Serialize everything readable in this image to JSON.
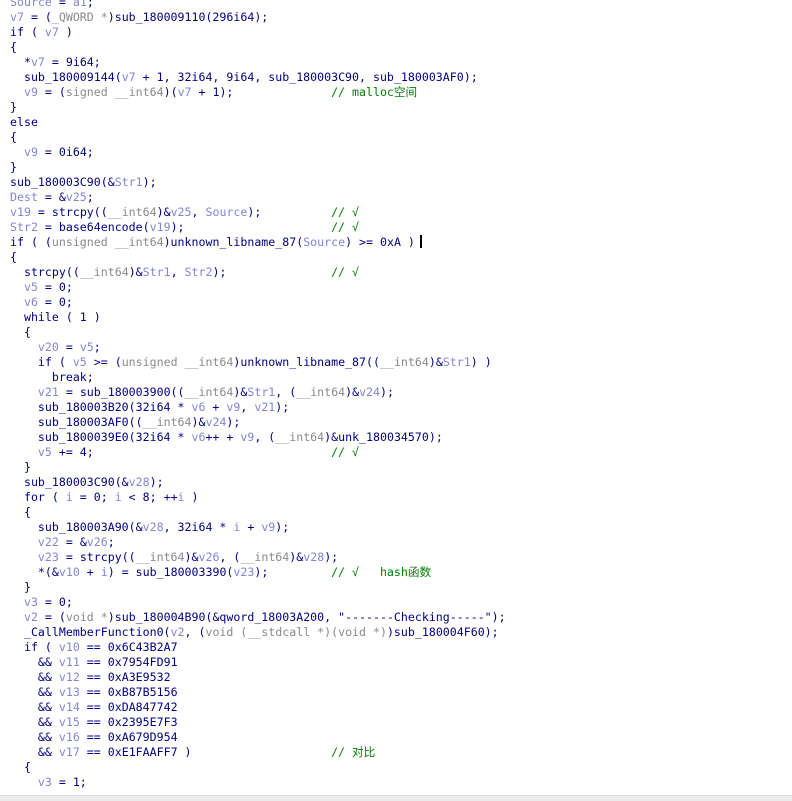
{
  "colors": {
    "identifier": "#000080",
    "variable": "#8484d2",
    "type": "#8a8a8a",
    "comment": "#008000"
  },
  "code": {
    "cursor_line": 16,
    "lines": [
      {
        "tokens": [
          [
            "v",
            "Source"
          ],
          [
            "n",
            " = "
          ],
          [
            "v",
            "a1"
          ],
          [
            "n",
            ";"
          ]
        ]
      },
      {
        "tokens": [
          [
            "v",
            "v7"
          ],
          [
            "n",
            " = ("
          ],
          [
            "t",
            "_QWORD *"
          ],
          [
            "n",
            ")sub_180009110(296i64);"
          ]
        ]
      },
      {
        "tokens": [
          [
            "n",
            "if ( "
          ],
          [
            "v",
            "v7"
          ],
          [
            "n",
            " )"
          ]
        ]
      },
      {
        "tokens": [
          [
            "n",
            "{"
          ]
        ]
      },
      {
        "tokens": [
          [
            "n",
            "  *"
          ],
          [
            "v",
            "v7"
          ],
          [
            "n",
            " = 9i64;"
          ]
        ]
      },
      {
        "tokens": [
          [
            "n",
            "  sub_180009144("
          ],
          [
            "v",
            "v7"
          ],
          [
            "n",
            " + 1, 32i64, 9i64, sub_180003C90, sub_180003AF0);"
          ]
        ]
      },
      {
        "tokens": [
          [
            "n",
            "  "
          ],
          [
            "v",
            "v9"
          ],
          [
            "n",
            " = ("
          ],
          [
            "t",
            "signed __int64"
          ],
          [
            "n",
            ")("
          ],
          [
            "v",
            "v7"
          ],
          [
            "n",
            " + 1);"
          ]
        ],
        "comment": "// malloc空间"
      },
      {
        "tokens": [
          [
            "n",
            "}"
          ]
        ]
      },
      {
        "tokens": [
          [
            "n",
            "else"
          ]
        ]
      },
      {
        "tokens": [
          [
            "n",
            "{"
          ]
        ]
      },
      {
        "tokens": [
          [
            "n",
            "  "
          ],
          [
            "v",
            "v9"
          ],
          [
            "n",
            " = 0i64;"
          ]
        ]
      },
      {
        "tokens": [
          [
            "n",
            "}"
          ]
        ]
      },
      {
        "tokens": [
          [
            "n",
            "sub_180003C90(&"
          ],
          [
            "v",
            "Str1"
          ],
          [
            "n",
            ");"
          ]
        ]
      },
      {
        "tokens": [
          [
            "v",
            "Dest"
          ],
          [
            "n",
            " = &"
          ],
          [
            "v",
            "v25"
          ],
          [
            "n",
            ";"
          ]
        ]
      },
      {
        "tokens": [
          [
            "v",
            "v19"
          ],
          [
            "n",
            " = strcpy(("
          ],
          [
            "t",
            "__int64"
          ],
          [
            "n",
            ")&"
          ],
          [
            "v",
            "v25"
          ],
          [
            "n",
            ", "
          ],
          [
            "v",
            "Source"
          ],
          [
            "n",
            ");"
          ]
        ],
        "comment": "// √"
      },
      {
        "tokens": [
          [
            "v",
            "Str2"
          ],
          [
            "n",
            " = base64encode("
          ],
          [
            "v",
            "v19"
          ],
          [
            "n",
            ");"
          ]
        ],
        "comment": "// √"
      },
      {
        "tokens": [
          [
            "n",
            "if ( ("
          ],
          [
            "t",
            "unsigned __int64"
          ],
          [
            "n",
            ")unknown_libname_87("
          ],
          [
            "v",
            "Source"
          ],
          [
            "n",
            ") >= 0xA )"
          ]
        ]
      },
      {
        "tokens": [
          [
            "n",
            "{"
          ]
        ]
      },
      {
        "tokens": [
          [
            "n",
            "  strcpy(("
          ],
          [
            "t",
            "__int64"
          ],
          [
            "n",
            ")&"
          ],
          [
            "v",
            "Str1"
          ],
          [
            "n",
            ", "
          ],
          [
            "v",
            "Str2"
          ],
          [
            "n",
            ");"
          ]
        ],
        "comment": "// √"
      },
      {
        "tokens": [
          [
            "n",
            "  "
          ],
          [
            "v",
            "v5"
          ],
          [
            "n",
            " = 0;"
          ]
        ]
      },
      {
        "tokens": [
          [
            "n",
            "  "
          ],
          [
            "v",
            "v6"
          ],
          [
            "n",
            " = 0;"
          ]
        ]
      },
      {
        "tokens": [
          [
            "n",
            "  while ( 1 )"
          ]
        ]
      },
      {
        "tokens": [
          [
            "n",
            "  {"
          ]
        ]
      },
      {
        "tokens": [
          [
            "n",
            "    "
          ],
          [
            "v",
            "v20"
          ],
          [
            "n",
            " = "
          ],
          [
            "v",
            "v5"
          ],
          [
            "n",
            ";"
          ]
        ]
      },
      {
        "tokens": [
          [
            "n",
            "    if ( "
          ],
          [
            "v",
            "v5"
          ],
          [
            "n",
            " >= ("
          ],
          [
            "t",
            "unsigned __int64"
          ],
          [
            "n",
            ")unknown_libname_87(("
          ],
          [
            "t",
            "__int64"
          ],
          [
            "n",
            ")&"
          ],
          [
            "v",
            "Str1"
          ],
          [
            "n",
            ") )"
          ]
        ]
      },
      {
        "tokens": [
          [
            "n",
            "      break;"
          ]
        ]
      },
      {
        "tokens": [
          [
            "n",
            "    "
          ],
          [
            "v",
            "v21"
          ],
          [
            "n",
            " = sub_180003900(("
          ],
          [
            "t",
            "__int64"
          ],
          [
            "n",
            ")&"
          ],
          [
            "v",
            "Str1"
          ],
          [
            "n",
            ", ("
          ],
          [
            "t",
            "__int64"
          ],
          [
            "n",
            ")&"
          ],
          [
            "v",
            "v24"
          ],
          [
            "n",
            ");"
          ]
        ]
      },
      {
        "tokens": [
          [
            "n",
            "    sub_180003B20(32i64 * "
          ],
          [
            "v",
            "v6"
          ],
          [
            "n",
            " + "
          ],
          [
            "v",
            "v9"
          ],
          [
            "n",
            ", "
          ],
          [
            "v",
            "v21"
          ],
          [
            "n",
            ");"
          ]
        ]
      },
      {
        "tokens": [
          [
            "n",
            "    sub_180003AF0(("
          ],
          [
            "t",
            "__int64"
          ],
          [
            "n",
            ")&"
          ],
          [
            "v",
            "v24"
          ],
          [
            "n",
            ");"
          ]
        ]
      },
      {
        "tokens": [
          [
            "n",
            "    sub_1800039E0(32i64 * "
          ],
          [
            "v",
            "v6"
          ],
          [
            "n",
            "++ + "
          ],
          [
            "v",
            "v9"
          ],
          [
            "n",
            ", ("
          ],
          [
            "t",
            "__int64"
          ],
          [
            "n",
            ")&unk_180034570);"
          ]
        ]
      },
      {
        "tokens": [
          [
            "n",
            "    "
          ],
          [
            "v",
            "v5"
          ],
          [
            "n",
            " += 4;"
          ]
        ],
        "comment": "// √"
      },
      {
        "tokens": [
          [
            "n",
            "  }"
          ]
        ]
      },
      {
        "tokens": [
          [
            "n",
            "  sub_180003C90(&"
          ],
          [
            "v",
            "v28"
          ],
          [
            "n",
            ");"
          ]
        ]
      },
      {
        "tokens": [
          [
            "n",
            "  for ( "
          ],
          [
            "v",
            "i"
          ],
          [
            "n",
            " = 0; "
          ],
          [
            "v",
            "i"
          ],
          [
            "n",
            " < 8; ++"
          ],
          [
            "v",
            "i"
          ],
          [
            "n",
            " )"
          ]
        ]
      },
      {
        "tokens": [
          [
            "n",
            "  {"
          ]
        ]
      },
      {
        "tokens": [
          [
            "n",
            "    sub_180003A90(&"
          ],
          [
            "v",
            "v28"
          ],
          [
            "n",
            ", 32i64 * "
          ],
          [
            "v",
            "i"
          ],
          [
            "n",
            " + "
          ],
          [
            "v",
            "v9"
          ],
          [
            "n",
            ");"
          ]
        ]
      },
      {
        "tokens": [
          [
            "n",
            "    "
          ],
          [
            "v",
            "v22"
          ],
          [
            "n",
            " = &"
          ],
          [
            "v",
            "v26"
          ],
          [
            "n",
            ";"
          ]
        ]
      },
      {
        "tokens": [
          [
            "n",
            "    "
          ],
          [
            "v",
            "v23"
          ],
          [
            "n",
            " = strcpy(("
          ],
          [
            "t",
            "__int64"
          ],
          [
            "n",
            ")&"
          ],
          [
            "v",
            "v26"
          ],
          [
            "n",
            ", ("
          ],
          [
            "t",
            "__int64"
          ],
          [
            "n",
            ")&"
          ],
          [
            "v",
            "v28"
          ],
          [
            "n",
            ");"
          ]
        ]
      },
      {
        "tokens": [
          [
            "n",
            "    *(&"
          ],
          [
            "v",
            "v10"
          ],
          [
            "n",
            " + "
          ],
          [
            "v",
            "i"
          ],
          [
            "n",
            ") = sub_180003390("
          ],
          [
            "v",
            "v23"
          ],
          [
            "n",
            ");"
          ]
        ],
        "comment": "// √   hash函数"
      },
      {
        "tokens": [
          [
            "n",
            "  }"
          ]
        ]
      },
      {
        "tokens": [
          [
            "n",
            "  "
          ],
          [
            "v",
            "v3"
          ],
          [
            "n",
            " = 0;"
          ]
        ]
      },
      {
        "tokens": [
          [
            "n",
            "  "
          ],
          [
            "v",
            "v2"
          ],
          [
            "n",
            " = ("
          ],
          [
            "t",
            "void *"
          ],
          [
            "n",
            ")sub_180004B90(&qword_18003A200, \"-------Checking-----\");"
          ]
        ]
      },
      {
        "tokens": [
          [
            "n",
            "  _CallMemberFunction0("
          ],
          [
            "v",
            "v2"
          ],
          [
            "n",
            ", ("
          ],
          [
            "t",
            "void (__stdcall *)(void *)"
          ],
          [
            "n",
            ")sub_180004F60);"
          ]
        ]
      },
      {
        "tokens": [
          [
            "n",
            "  if ( "
          ],
          [
            "v",
            "v10"
          ],
          [
            "n",
            " == 0x6C43B2A7"
          ]
        ]
      },
      {
        "tokens": [
          [
            "n",
            "    && "
          ],
          [
            "v",
            "v11"
          ],
          [
            "n",
            " == 0x7954FD91"
          ]
        ]
      },
      {
        "tokens": [
          [
            "n",
            "    && "
          ],
          [
            "v",
            "v12"
          ],
          [
            "n",
            " == 0xA3E9532"
          ]
        ]
      },
      {
        "tokens": [
          [
            "n",
            "    && "
          ],
          [
            "v",
            "v13"
          ],
          [
            "n",
            " == 0xB87B5156"
          ]
        ]
      },
      {
        "tokens": [
          [
            "n",
            "    && "
          ],
          [
            "v",
            "v14"
          ],
          [
            "n",
            " == 0xDA847742"
          ]
        ]
      },
      {
        "tokens": [
          [
            "n",
            "    && "
          ],
          [
            "v",
            "v15"
          ],
          [
            "n",
            " == 0x2395E7F3"
          ]
        ]
      },
      {
        "tokens": [
          [
            "n",
            "    && "
          ],
          [
            "v",
            "v16"
          ],
          [
            "n",
            " == 0xA679D954"
          ]
        ]
      },
      {
        "tokens": [
          [
            "n",
            "    && "
          ],
          [
            "v",
            "v17"
          ],
          [
            "n",
            " == 0xE1FAAFF7 )"
          ]
        ],
        "comment": "// 对比"
      },
      {
        "tokens": [
          [
            "n",
            "  {"
          ]
        ]
      },
      {
        "tokens": [
          [
            "n",
            "    "
          ],
          [
            "v",
            "v3"
          ],
          [
            "n",
            " = 1;"
          ]
        ]
      }
    ]
  }
}
